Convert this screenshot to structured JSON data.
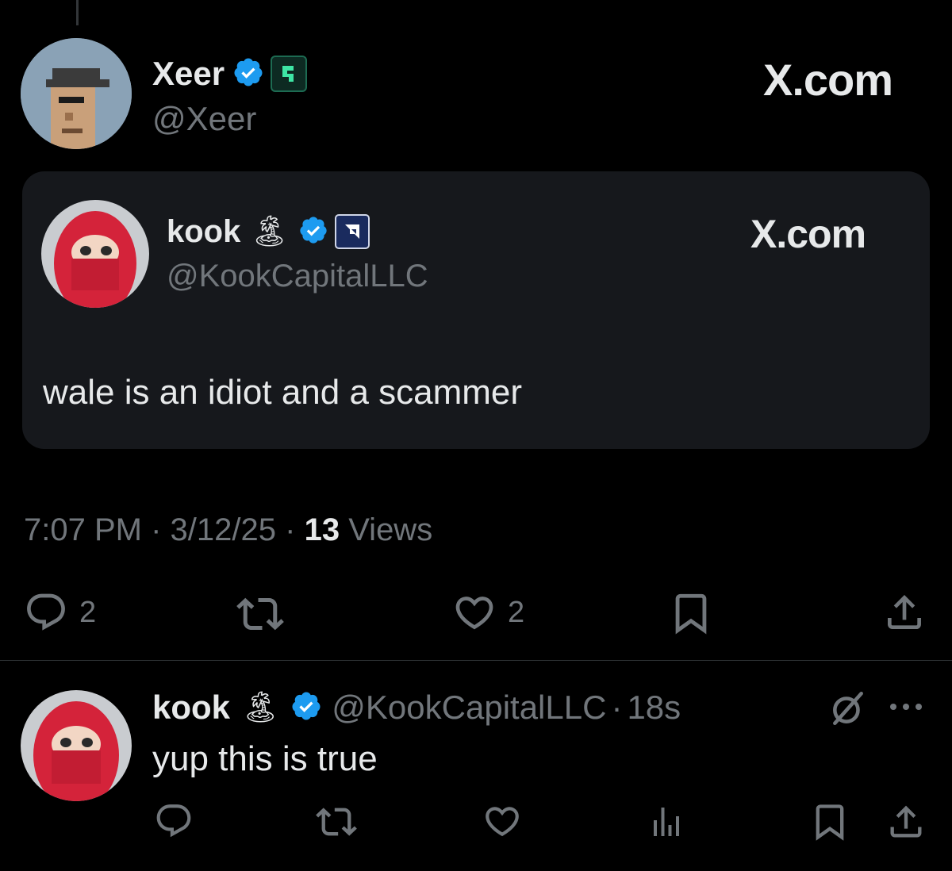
{
  "main_tweet": {
    "author_name": "Xeer",
    "author_handle": "@Xeer",
    "watermark": "X.com"
  },
  "quoted_tweet": {
    "author_name": "kook",
    "author_emoji": "🏝",
    "author_handle": "@KookCapitalLLC",
    "watermark": "X.com",
    "text": "wale is an idiot and a scammer"
  },
  "meta": {
    "time": "7:07 PM",
    "sep1": "·",
    "date": "3/12/25",
    "sep2": "·",
    "views_count": "13",
    "views_label": "Views"
  },
  "actions": {
    "replies": "2",
    "likes": "2"
  },
  "reply": {
    "author_name": "kook",
    "author_emoji": "🏝",
    "author_handle": "@KookCapitalLLC",
    "sep": "·",
    "time": "18s",
    "text": "yup this is true"
  },
  "colors": {
    "background": "#000000",
    "card": "#16181c",
    "verified": "#1d9bf0",
    "muted": "#71767b",
    "text": "#e7e9ea"
  },
  "icons": [
    "reply-icon",
    "retweet-icon",
    "like-icon",
    "bookmark-icon",
    "share-icon",
    "views-icon",
    "grok-icon",
    "more-icon",
    "verified-icon"
  ]
}
